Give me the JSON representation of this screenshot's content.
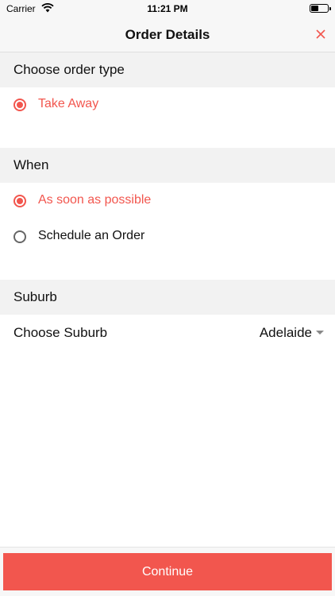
{
  "status_bar": {
    "carrier": "Carrier",
    "time": "11:21 PM",
    "icons": [
      "wifi-icon",
      "battery-icon"
    ]
  },
  "nav": {
    "title": "Order Details",
    "close_icon": "close-icon"
  },
  "order_type": {
    "header": "Choose order type",
    "options": [
      {
        "label": "Take Away",
        "selected": true
      }
    ]
  },
  "when": {
    "header": "When",
    "options": [
      {
        "label": "As soon as possible",
        "selected": true
      },
      {
        "label": "Schedule an Order",
        "selected": false
      }
    ]
  },
  "suburb": {
    "header": "Suburb",
    "label": "Choose Suburb",
    "value": "Adelaide"
  },
  "footer": {
    "continue_label": "Continue"
  },
  "colors": {
    "accent": "#f2564e",
    "section_bg": "#f2f2f2",
    "bar_bg": "#f7f7f7"
  }
}
